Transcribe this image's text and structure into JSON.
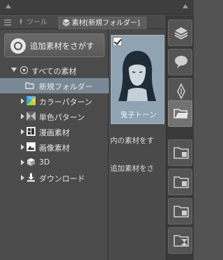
{
  "tabs": [
    {
      "label": "ツール",
      "icon": "pen-tool-icon"
    },
    {
      "label": "素材[新規フォルダー]",
      "icon": "material-stack-icon"
    }
  ],
  "search_button": {
    "label": "追加素材をさがす",
    "icon": "search-material-icon"
  },
  "tree": {
    "root": "すべての素材",
    "items": [
      {
        "label": "新規フォルダー",
        "icon": "folder-icon",
        "selected": true
      },
      {
        "label": "カラーパターン",
        "icon": "color-pattern-icon"
      },
      {
        "label": "単色パターン",
        "icon": "mono-pattern-icon"
      },
      {
        "label": "漫画素材",
        "icon": "manga-material-icon"
      },
      {
        "label": "画像素材",
        "icon": "image-material-icon"
      },
      {
        "label": "3D",
        "icon": "3d-cube-icon"
      },
      {
        "label": "ダウンロード",
        "icon": "download-icon"
      }
    ]
  },
  "thumbnail": {
    "caption": "鬼子トーン",
    "checked": true
  },
  "messages": [
    "内の素材をす",
    "追加素材をさ"
  ],
  "colors": {
    "panel": "#4b4b4b",
    "selection": "#7a8896",
    "thumbnail_bg": "#8fa3b3"
  }
}
